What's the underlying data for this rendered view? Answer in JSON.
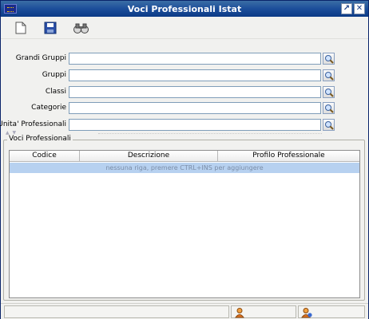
{
  "window": {
    "title": "Voci Professionali Istat"
  },
  "titlebar_buttons": {
    "maximize": "↗",
    "close": "✕"
  },
  "toolbar": {
    "items": [
      "new-document-icon",
      "save-icon",
      "binoculars-icon"
    ]
  },
  "form": {
    "fields": [
      {
        "label": "Grandi Gruppi",
        "value": ""
      },
      {
        "label": "Gruppi",
        "value": ""
      },
      {
        "label": "Classi",
        "value": ""
      },
      {
        "label": "Categorie",
        "value": ""
      },
      {
        "label": "Unita' Professionali",
        "value": ""
      }
    ]
  },
  "group": {
    "legend": "Voci Professionali",
    "columns": [
      "Codice",
      "Descrizione",
      "Profilo Professionale"
    ],
    "empty_message": "nessuna riga, premere CTRL+INS per aggiungere"
  },
  "statusbar": {
    "cells": [
      "",
      "user-icon",
      "user-info-icon"
    ]
  },
  "colors": {
    "titlebar": "#1c4e9a",
    "selection_row": "#b7d1f0",
    "input_border": "#7f9db9"
  }
}
